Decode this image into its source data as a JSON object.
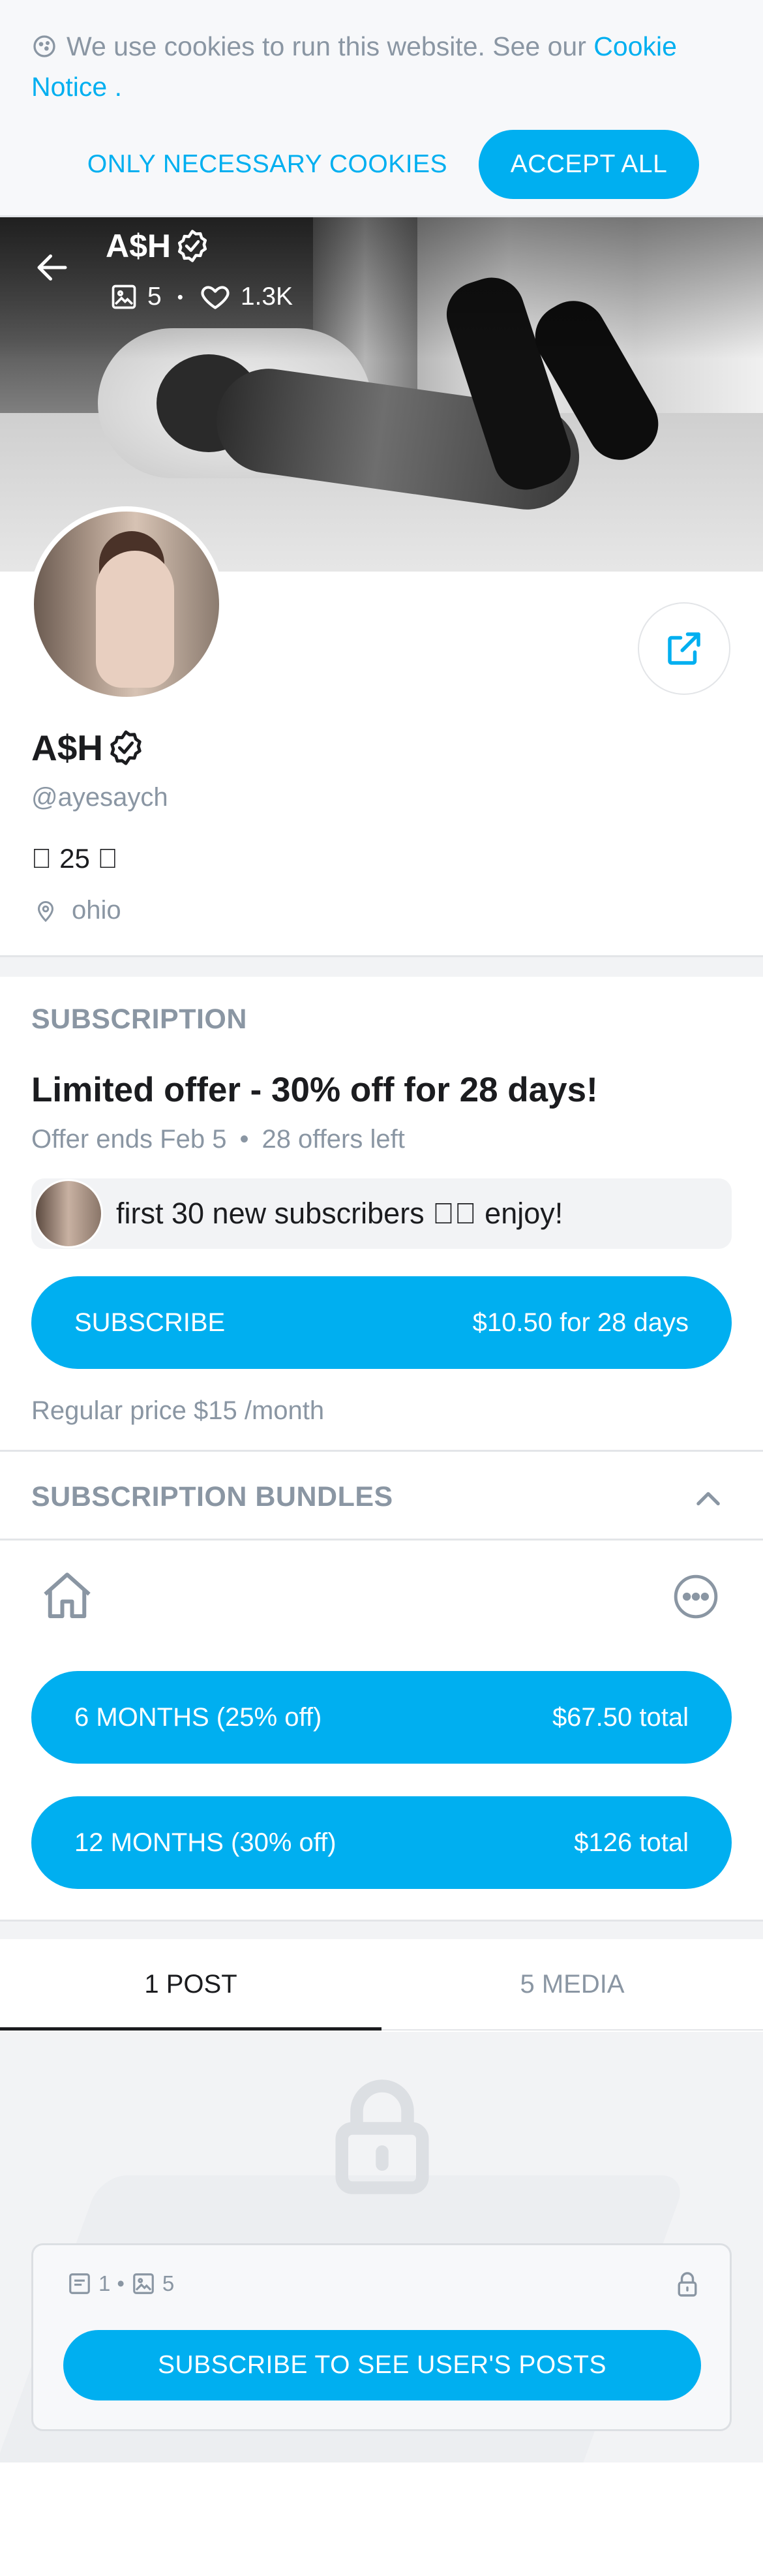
{
  "cookie": {
    "text": "We use cookies to run this website. See our",
    "link": "Cookie Notice",
    "link_suffix": " .",
    "only_necessary": "ONLY NECESSARY COOKIES",
    "accept_all": "ACCEPT ALL"
  },
  "header": {
    "name": "A$H",
    "media_count": "5",
    "likes": "1.3K",
    "dot": "•"
  },
  "profile": {
    "name": "A$H",
    "handle": "@ayesaych",
    "bio": "\u0000 25 \u0000",
    "location": "ohio"
  },
  "subscription": {
    "title": "SUBSCRIPTION",
    "offer_title": "Limited offer - 30% off for 28 days!",
    "offer_ends": "Offer ends Feb 5",
    "offers_left": "28 offers left",
    "promo_message": "first 30 new subscribers \u0000\u0000 enjoy!",
    "subscribe_label": "SUBSCRIBE",
    "subscribe_price": "$10.50 for 28 days",
    "regular_price": "Regular price $15 /month"
  },
  "bundles": {
    "title": "SUBSCRIPTION BUNDLES",
    "items": [
      {
        "label": "6 MONTHS (25% off)",
        "price": "$67.50 total"
      },
      {
        "label": "12 MONTHS (30% off)",
        "price": "$126 total"
      }
    ]
  },
  "tabs": [
    {
      "label": "1 POST",
      "active": true
    },
    {
      "label": "5 MEDIA",
      "active": false
    }
  ],
  "locked": {
    "posts_count": "1",
    "media_count": "5",
    "dot": "•",
    "cta": "SUBSCRIBE TO SEE USER'S POSTS"
  },
  "colors": {
    "accent": "#00aff0",
    "muted": "#8a96a3",
    "text": "#1b1c1f"
  }
}
